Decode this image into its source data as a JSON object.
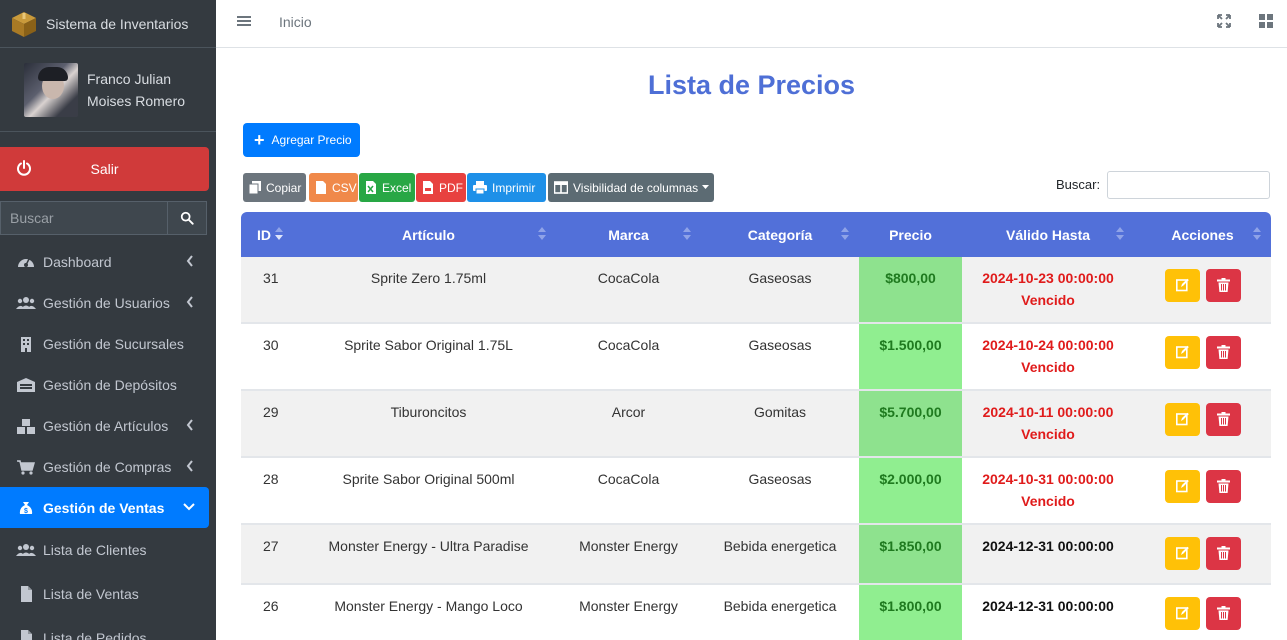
{
  "app": {
    "title": "Sistema de Inventarios"
  },
  "user": {
    "name_line1": "Franco Julian",
    "name_line2": "Moises Romero"
  },
  "sidebar": {
    "logout_label": "Salir",
    "search_placeholder": "Buscar",
    "items": [
      {
        "label": "Dashboard",
        "icon": "tachometer-icon"
      },
      {
        "label": "Gestión de Usuarios",
        "icon": "users-icon"
      },
      {
        "label": "Gestión de Sucursales",
        "icon": "building-icon"
      },
      {
        "label": "Gestión de Depósitos",
        "icon": "warehouse-icon"
      },
      {
        "label": "Gestión de Artículos",
        "icon": "boxes-icon"
      },
      {
        "label": "Gestión de Compras",
        "icon": "cart-icon"
      },
      {
        "label": "Gestión de Ventas",
        "icon": "money-bag-icon"
      },
      {
        "label": "Lista de Clientes",
        "icon": "users-icon"
      },
      {
        "label": "Lista de Ventas",
        "icon": "file-icon"
      },
      {
        "label": "Lista de Pedidos",
        "icon": "file-icon"
      }
    ]
  },
  "topbar": {
    "breadcrumb": "Inicio"
  },
  "page": {
    "title": "Lista de Precios",
    "add_button": "Agregar Precio",
    "search_label": "Buscar:"
  },
  "export_buttons": {
    "copy": "Copiar",
    "csv": "CSV",
    "excel": "Excel",
    "pdf": "PDF",
    "print": "Imprimir",
    "columns": "Visibilidad de columnas"
  },
  "colors": {
    "primary": "#007bff",
    "header": "#5270d9",
    "title": "#4e6fd6",
    "price_bg": "#90ee90",
    "expired": "#e01b1b",
    "edit": "#ffc107",
    "delete": "#dc3545"
  },
  "table": {
    "headers": [
      "ID",
      "Artículo",
      "Marca",
      "Categoría",
      "Precio",
      "Válido Hasta",
      "Acciones"
    ],
    "rows": [
      {
        "id": "31",
        "articulo": "Sprite Zero 1.75ml",
        "marca": "CocaCola",
        "categoria": "Gaseosas",
        "precio": "$800,00",
        "valido": "2024-10-23 00:00:00",
        "estado": "Vencido"
      },
      {
        "id": "30",
        "articulo": "Sprite Sabor Original 1.75L",
        "marca": "CocaCola",
        "categoria": "Gaseosas",
        "precio": "$1.500,00",
        "valido": "2024-10-24 00:00:00",
        "estado": "Vencido"
      },
      {
        "id": "29",
        "articulo": "Tiburoncitos",
        "marca": "Arcor",
        "categoria": "Gomitas",
        "precio": "$5.700,00",
        "valido": "2024-10-11 00:00:00",
        "estado": "Vencido"
      },
      {
        "id": "28",
        "articulo": "Sprite Sabor Original 500ml",
        "marca": "CocaCola",
        "categoria": "Gaseosas",
        "precio": "$2.000,00",
        "valido": "2024-10-31 00:00:00",
        "estado": "Vencido"
      },
      {
        "id": "27",
        "articulo": "Monster Energy - Ultra Paradise",
        "marca": "Monster Energy",
        "categoria": "Bebida energetica",
        "precio": "$1.850,00",
        "valido": "2024-12-31 00:00:00",
        "estado": ""
      },
      {
        "id": "26",
        "articulo": "Monster Energy - Mango Loco",
        "marca": "Monster Energy",
        "categoria": "Bebida energetica",
        "precio": "$1.800,00",
        "valido": "2024-12-31 00:00:00",
        "estado": ""
      }
    ]
  }
}
